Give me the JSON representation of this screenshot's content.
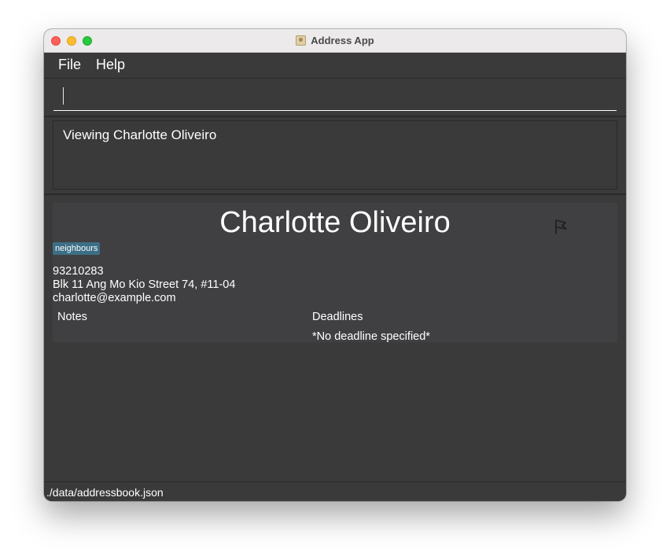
{
  "window": {
    "title": "Address App"
  },
  "menu": {
    "items": [
      {
        "label": "File"
      },
      {
        "label": "Help"
      }
    ]
  },
  "command_box": {
    "value": ""
  },
  "result_display": {
    "text": "Viewing Charlotte Oliveiro"
  },
  "person": {
    "name": "Charlotte Oliveiro",
    "tags": [
      "neighbours"
    ],
    "phone": "93210283",
    "address": "Blk 11 Ang Mo Kio Street 74, #11-04",
    "email": "charlotte@example.com",
    "notes_header": "Notes",
    "deadlines_header": "Deadlines",
    "deadline_value": "*No deadline specified*",
    "flag_icon": "flag-outline-icon"
  },
  "status_bar": {
    "path": "./data/addressbook.json"
  },
  "colors": {
    "background": "#3a3a3b",
    "panel": "#404043",
    "tag": "#3c6f86",
    "text": "#ffffff"
  }
}
